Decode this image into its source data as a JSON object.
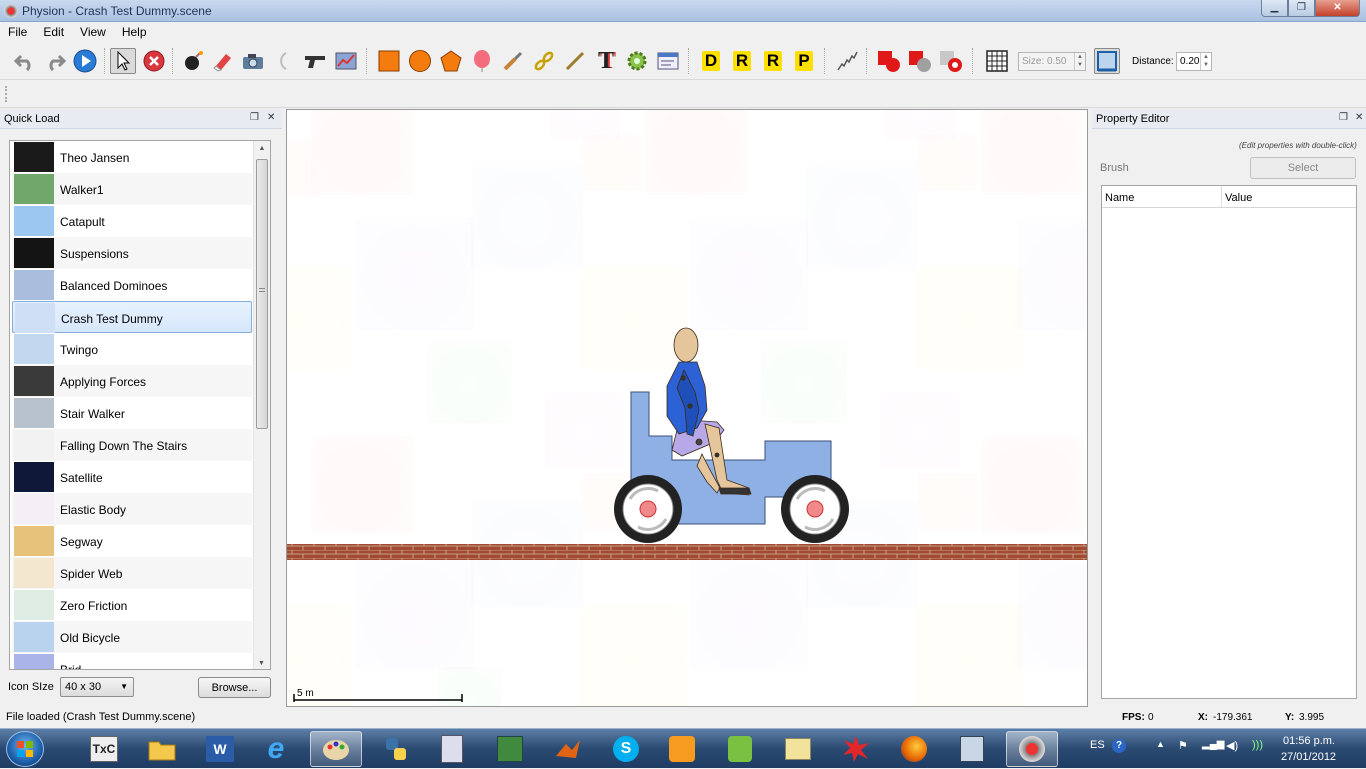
{
  "window": {
    "title": "Physion - Crash Test Dummy.scene"
  },
  "menu": [
    "File",
    "Edit",
    "View",
    "Help"
  ],
  "toolbar": {
    "size_label": "Size: 0.50",
    "distance_label": "Distance:",
    "distance_value": "0.20",
    "text_tool": "T",
    "d_tool": "D",
    "r_tool": "R",
    "rp_tool": "R",
    "p_tool": "P"
  },
  "quick_load": {
    "title": "Quick Load",
    "items": [
      {
        "name": "Theo Jansen"
      },
      {
        "name": "Walker1"
      },
      {
        "name": "Catapult"
      },
      {
        "name": "Suspensions"
      },
      {
        "name": "Balanced Dominoes"
      },
      {
        "name": "Crash Test Dummy"
      },
      {
        "name": "Twingo"
      },
      {
        "name": "Applying Forces"
      },
      {
        "name": "Stair Walker"
      },
      {
        "name": "Falling Down The Stairs"
      },
      {
        "name": "Satellite"
      },
      {
        "name": "Elastic Body"
      },
      {
        "name": "Segway"
      },
      {
        "name": "Spider Web"
      },
      {
        "name": "Zero Friction"
      },
      {
        "name": "Old Bicycle"
      },
      {
        "name": "Brid..."
      }
    ],
    "icon_size_label": "Icon SIze",
    "icon_size_value": "40 x 30",
    "browse_label": "Browse..."
  },
  "scene": {
    "scale_label": "5 m"
  },
  "property_editor": {
    "title": "Property Editor",
    "hint": "(Edit properties with double-click)",
    "brush_label": "Brush",
    "select_label": "Select",
    "col_name": "Name",
    "col_value": "Value"
  },
  "status": {
    "message": "File loaded (Crash Test Dummy.scene)",
    "fps_label": "FPS:",
    "fps": "0",
    "x_label": "X:",
    "x": "-179.361",
    "y_label": "Y:",
    "y": "3.995"
  },
  "taskbar": {
    "lang": "ES",
    "time": "01:56 p.m.",
    "date": "27/01/2012"
  }
}
